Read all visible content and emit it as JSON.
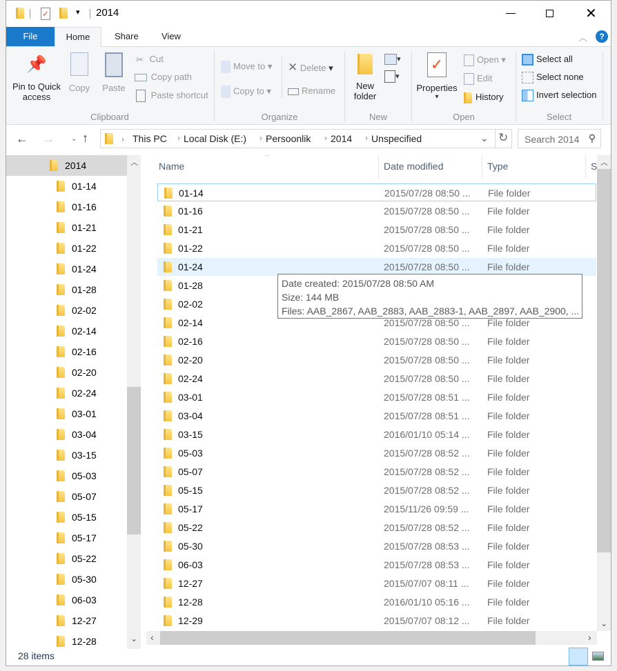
{
  "window": {
    "title": "2014",
    "minimize_icon": "minimize-icon",
    "maximize_icon": "maximize-icon",
    "close_icon": "close-icon"
  },
  "tabs": [
    {
      "label": "File"
    },
    {
      "label": "Home"
    },
    {
      "label": "Share"
    },
    {
      "label": "View"
    }
  ],
  "ribbon": {
    "clipboard": {
      "label": "Clipboard",
      "pin": "Pin to Quick access",
      "pin1": "Pin to Quick",
      "pin2": "access",
      "copy": "Copy",
      "paste": "Paste",
      "cut": "Cut",
      "copy_path": "Copy path",
      "paste_shortcut": "Paste shortcut"
    },
    "organize": {
      "label": "Organize",
      "move_to": "Move to",
      "copy_to": "Copy to",
      "delete": "Delete",
      "rename": "Rename"
    },
    "new": {
      "label": "New",
      "new_folder1": "New",
      "new_folder2": "folder"
    },
    "open": {
      "label": "Open",
      "properties": "Properties",
      "open": "Open",
      "edit": "Edit",
      "history": "History"
    },
    "select": {
      "label": "Select",
      "select_all": "Select all",
      "select_none": "Select none",
      "invert": "Invert selection"
    }
  },
  "address": {
    "crumbs": [
      "This PC",
      "Local Disk (E:)",
      "Persoonlik",
      "2014",
      "Unspecified"
    ],
    "search_placeholder": "Search 2014"
  },
  "nav": {
    "parent": "2014",
    "items": [
      "01-14",
      "01-16",
      "01-21",
      "01-22",
      "01-24",
      "01-28",
      "02-02",
      "02-14",
      "02-16",
      "02-20",
      "02-24",
      "03-01",
      "03-04",
      "03-15",
      "05-03",
      "05-07",
      "05-15",
      "05-17",
      "05-22",
      "05-30",
      "06-03",
      "12-27",
      "12-28"
    ]
  },
  "columns": {
    "name": "Name",
    "date": "Date modified",
    "type": "Type",
    "size": "S"
  },
  "files": [
    {
      "name": "01-14",
      "date": "2015/07/28 08:50 ...",
      "type": "File folder"
    },
    {
      "name": "01-16",
      "date": "2015/07/28 08:50 ...",
      "type": "File folder"
    },
    {
      "name": "01-21",
      "date": "2015/07/28 08:50 ...",
      "type": "File folder"
    },
    {
      "name": "01-22",
      "date": "2015/07/28 08:50 ...",
      "type": "File folder"
    },
    {
      "name": "01-24",
      "date": "2015/07/28 08:50 ...",
      "type": "File folder"
    },
    {
      "name": "01-28",
      "date": "",
      "type": ""
    },
    {
      "name": "02-02",
      "date": "",
      "type": ""
    },
    {
      "name": "02-14",
      "date": "2015/07/28 08:50 ...",
      "type": "File folder"
    },
    {
      "name": "02-16",
      "date": "2015/07/28 08:50 ...",
      "type": "File folder"
    },
    {
      "name": "02-20",
      "date": "2015/07/28 08:50 ...",
      "type": "File folder"
    },
    {
      "name": "02-24",
      "date": "2015/07/28 08:50 ...",
      "type": "File folder"
    },
    {
      "name": "03-01",
      "date": "2015/07/28 08:51 ...",
      "type": "File folder"
    },
    {
      "name": "03-04",
      "date": "2015/07/28 08:51 ...",
      "type": "File folder"
    },
    {
      "name": "03-15",
      "date": "2016/01/10 05:14 ...",
      "type": "File folder"
    },
    {
      "name": "05-03",
      "date": "2015/07/28 08:52 ...",
      "type": "File folder"
    },
    {
      "name": "05-07",
      "date": "2015/07/28 08:52 ...",
      "type": "File folder"
    },
    {
      "name": "05-15",
      "date": "2015/07/28 08:52 ...",
      "type": "File folder"
    },
    {
      "name": "05-17",
      "date": "2015/11/26 09:59 ...",
      "type": "File folder"
    },
    {
      "name": "05-22",
      "date": "2015/07/28 08:52 ...",
      "type": "File folder"
    },
    {
      "name": "05-30",
      "date": "2015/07/28 08:53 ...",
      "type": "File folder"
    },
    {
      "name": "06-03",
      "date": "2015/07/28 08:53 ...",
      "type": "File folder"
    },
    {
      "name": "12-27",
      "date": "2015/07/07 08:11 ...",
      "type": "File folder"
    },
    {
      "name": "12-28",
      "date": "2016/01/10 05:16 ...",
      "type": "File folder"
    },
    {
      "name": "12-29",
      "date": "2015/07/07 08:12 ...",
      "type": "File folder"
    }
  ],
  "tooltip": {
    "created": "Date created: 2015/07/28 08:50 AM",
    "size": "Size: 144 MB",
    "files": "Files: AAB_2867, AAB_2883, AAB_2883-1, AAB_2897, AAB_2900, ..."
  },
  "status": {
    "count": "28 items"
  },
  "colors": {
    "accent": "#1979ca",
    "hover": "#e5f3ff",
    "selected_border": "#99d1ff"
  }
}
